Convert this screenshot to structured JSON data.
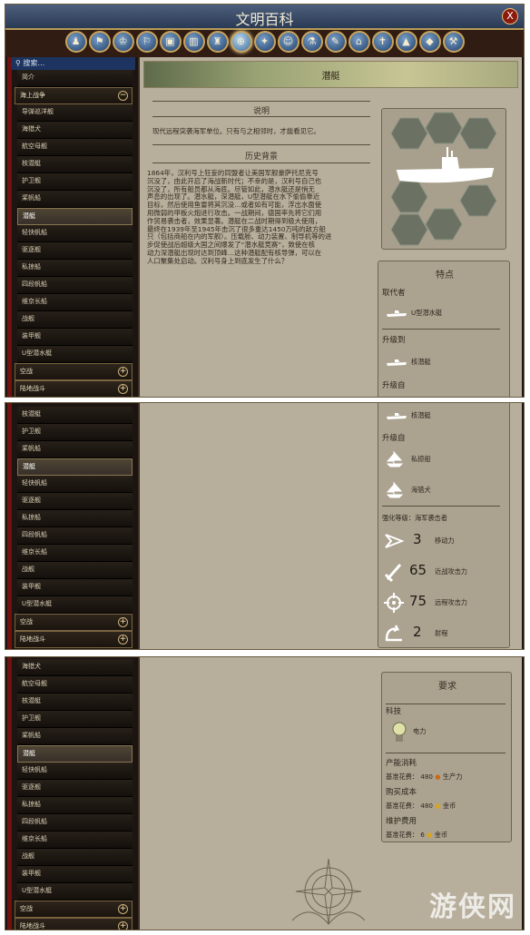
{
  "window": {
    "title": "文明百科",
    "close": "X"
  },
  "categories": [
    {
      "icon": "game-concepts-icon"
    },
    {
      "icon": "civilizations-icon"
    },
    {
      "icon": "leaders-icon"
    },
    {
      "icon": "city-states-icon"
    },
    {
      "icon": "districts-icon"
    },
    {
      "icon": "buildings-icon"
    },
    {
      "icon": "wonders-icon"
    },
    {
      "icon": "units-icon",
      "selected": true
    },
    {
      "icon": "unit-promotions-icon"
    },
    {
      "icon": "great-people-icon"
    },
    {
      "icon": "technologies-icon"
    },
    {
      "icon": "civics-icon"
    },
    {
      "icon": "governments-icon"
    },
    {
      "icon": "religions-icon"
    },
    {
      "icon": "features-icon"
    },
    {
      "icon": "resources-icon"
    },
    {
      "icon": "improvements-icon"
    }
  ],
  "sidebar": {
    "search": "搜索…",
    "p1": [
      "简介",
      "海上战争",
      "导弹巡洋舰",
      "海猎犬",
      "航空母舰",
      "核潜艇",
      "护卫舰",
      "桨帆船",
      "潜艇",
      "轻快帆船",
      "驱逐舰",
      "私掠船",
      "四段帆船",
      "维京长船",
      "战舰",
      "装甲舰",
      "U型潜水艇",
      "空战",
      "陆地战斗"
    ],
    "p2": [
      "核潜艇",
      "护卫舰",
      "桨帆船",
      "潜艇",
      "轻快帆船",
      "驱逐舰",
      "私掠船",
      "四段帆船",
      "维京长船",
      "战舰",
      "装甲舰",
      "U型潜水艇",
      "空战",
      "陆地战斗"
    ],
    "p3": [
      "海猎犬",
      "航空母舰",
      "核潜艇",
      "护卫舰",
      "桨帆船",
      "潜艇",
      "轻快帆船",
      "驱逐舰",
      "私掠船",
      "四段帆船",
      "维京长船",
      "战舰",
      "装甲舰",
      "U型潜水艇",
      "空战",
      "陆地战斗"
    ]
  },
  "page": {
    "title": "潜艇",
    "desc_header": "说明",
    "description": "现代远程突袭海军单位。只有与之相邻时，才能看见它。",
    "history_header": "历史背景",
    "history": [
      "1864年，汉利号上狂妄的同盟者让美国军舰豪萨托尼克号",
      "沉没了，由此开启了海战新时代；不幸的是，汉利号自己也",
      "沉没了，所有船员都从海底。尽管如此，潜水艇还是悄无",
      "声息的出现了。潜水艇，深潜艇，U型潜艇在水下偷偷靠近",
      "目标，然后使用鱼雷将其沉没…或者如有可能，浮出水面使",
      "用微弱的甲板火炮进行攻击。一战期间，德国率先将它们用",
      "作贸易袭击者，效果显著。潜艇在二战时期得到极大使用，",
      "最终在1939年至1945年击沉了很多重达1450万吨的敌方船",
      "只（包括商船在内的军舰）。压载舱、动力装置、制导机等的进",
      "步促使战后超级大国之间爆发了“潜水艇竞赛”，致使在核",
      "动力深潜艇出现时达到顶峰…这种潜艇配有核导弹，可以在",
      "人口聚集处启动。汉利号身上到底发生了什么？"
    ],
    "traits_header": "特点",
    "replaces_label": "取代者",
    "replaces": "U型潜水艇",
    "upgrades_to_label": "升级到",
    "upgrades_to": "核潜艇",
    "upgrades_from_label": "升级自",
    "upgrades_from": [
      "私掠船",
      "海猎犬"
    ],
    "promotion_class": "强化等级：海军袭击者",
    "stats": [
      {
        "icon": "movement-icon",
        "value": "3",
        "label": "移动力"
      },
      {
        "icon": "melee-strength-icon",
        "value": "65",
        "label": "近战攻击力"
      },
      {
        "icon": "ranged-strength-icon",
        "value": "75",
        "label": "远程攻击力"
      },
      {
        "icon": "range-icon",
        "value": "2",
        "label": "射程"
      }
    ],
    "req_header": "要求",
    "tech_label": "科技",
    "tech": "电力",
    "prod_label": "产能消耗",
    "prod_cost": "基准花费：",
    "prod_value": "480",
    "prod_unit": "生产力",
    "buy_label": "购买成本",
    "buy_cost": "基准花费：",
    "buy_value": "480",
    "buy_unit": "金币",
    "maint_label": "维护费用",
    "maint_cost": "基准花费：",
    "maint_value": "6",
    "maint_unit": "金币"
  },
  "watermark": "游侠网",
  "colors": {
    "content_bg": "#b7ae9c",
    "sidebar_bg": "#1d1511",
    "frame_red": "#6f1210",
    "title_blue": "#2a3a55"
  }
}
